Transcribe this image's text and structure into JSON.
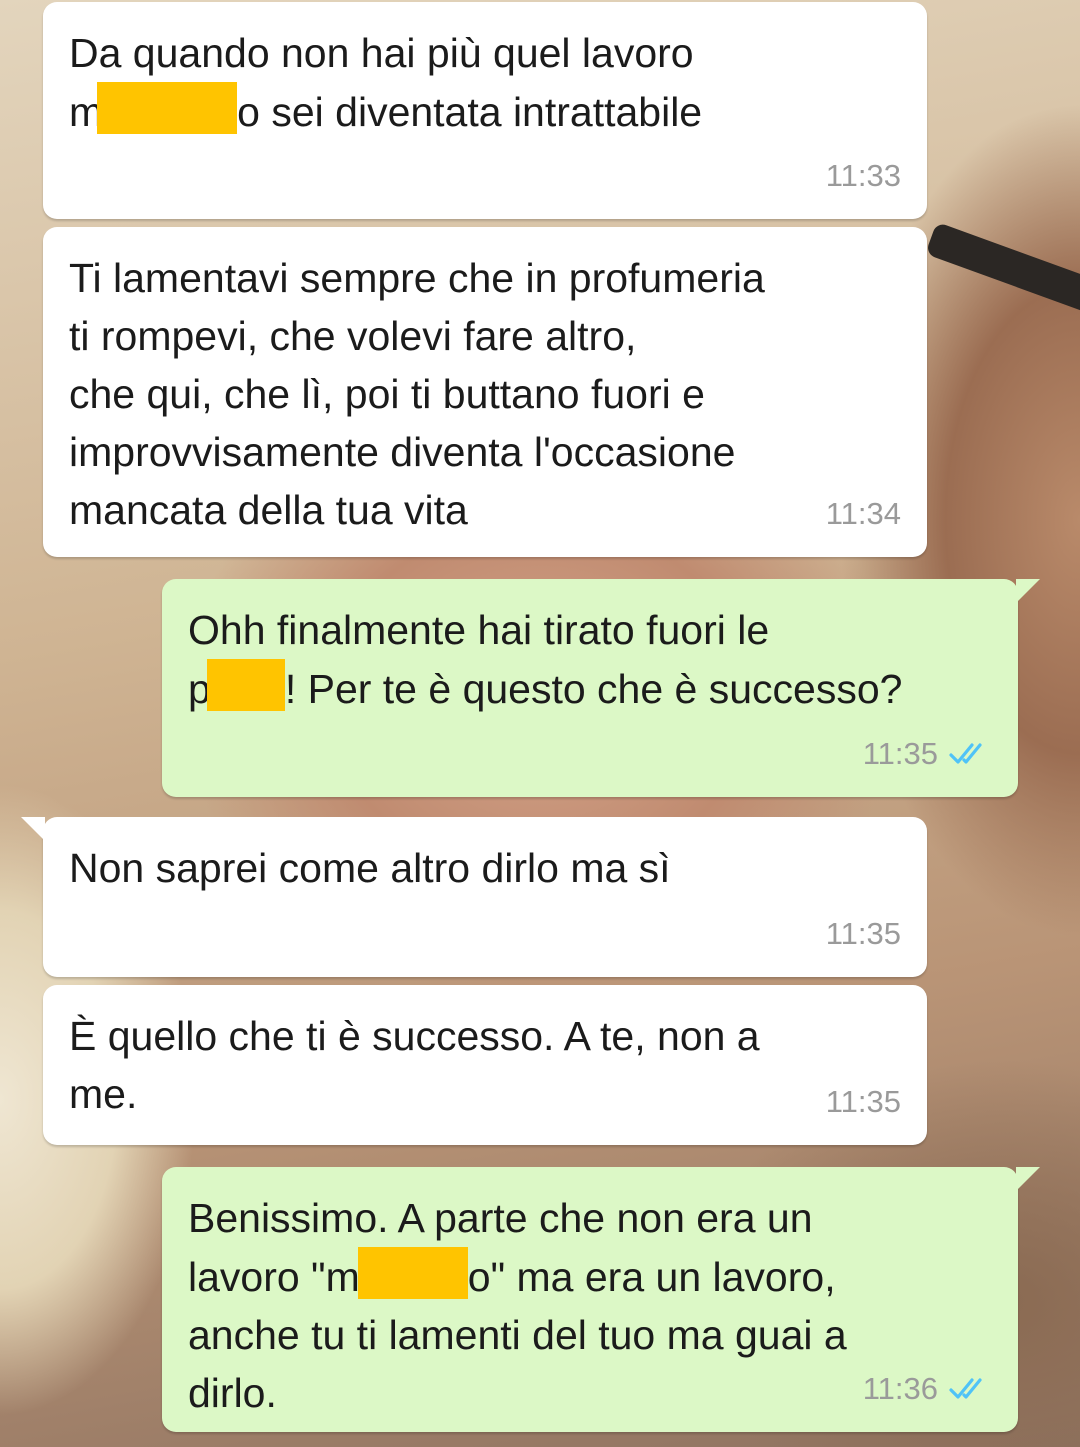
{
  "messages": [
    {
      "direction": "incoming",
      "line1": "Da quando non hai più quel lavoro",
      "line2_pre": "m",
      "line2_post": "o sei diventata intrattabile",
      "time": "11:33"
    },
    {
      "direction": "incoming",
      "text": "Ti lamentavi sempre che in profumeria\nti rompevi, che volevi fare altro,\nche qui, che lì, poi ti buttano fuori e\nimprovvisamente diventa l'occasione\nmancata della tua vita",
      "time": "11:34"
    },
    {
      "direction": "outgoing",
      "line1": "Ohh finalmente hai tirato fuori le",
      "line2_pre": "p",
      "line2_post": "! Per te è questo che è successo?",
      "time": "11:35",
      "status": "read"
    },
    {
      "direction": "incoming",
      "text": "Non saprei come altro dirlo ma sì",
      "time": "11:35"
    },
    {
      "direction": "incoming",
      "text": "È quello che ti è successo. A te, non a\nme.",
      "time": "11:35"
    },
    {
      "direction": "outgoing",
      "line1": "Benissimo. A parte che non era un",
      "line2_pre": "lavoro \"m",
      "line2_post": "o\" ma era un lavoro,",
      "rest": "anche tu ti lamenti del tuo ma guai a\ndirlo.",
      "time": "11:36",
      "status": "read"
    }
  ],
  "colors": {
    "incoming": "#ffffff",
    "outgoing": "#dcf8c6",
    "redaction": "#ffc400",
    "read_ticks": "#4fc3f7",
    "timestamp": "#9a9a9a"
  }
}
